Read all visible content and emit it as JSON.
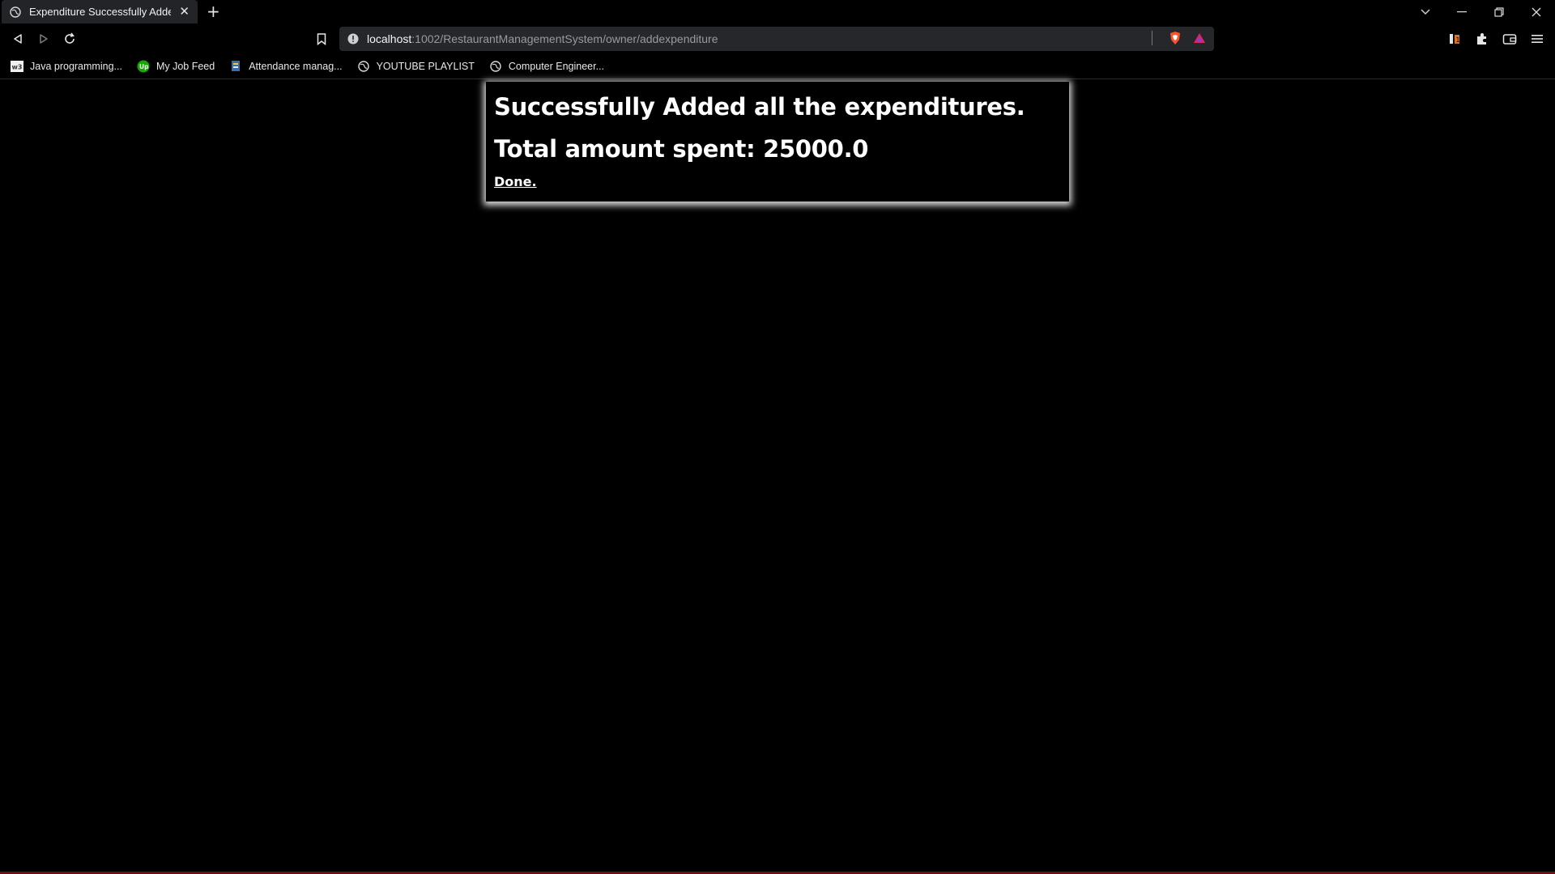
{
  "browser": {
    "tab": {
      "title": "Expenditure Successfully Added."
    },
    "address": {
      "host": "localhost",
      "path": ":1002/RestaurantManagementSystem/owner/addexpenditure"
    },
    "bookmarks": [
      {
        "label": "Java programming...",
        "icon": "w3-icon"
      },
      {
        "label": "My Job Feed",
        "icon": "upwork-icon"
      },
      {
        "label": "Attendance manag...",
        "icon": "app-icon"
      },
      {
        "label": "YOUTUBE PLAYLIST",
        "icon": "globe-icon"
      },
      {
        "label": "Computer Engineer...",
        "icon": "globe-icon"
      }
    ],
    "colors": {
      "brave_orange": "#fb542b",
      "upwork_green": "#14a800",
      "rewards_red": "#e0245e"
    }
  },
  "page": {
    "message": "Successfully Added all the expenditures.",
    "total": "Total amount spent: 25000.0",
    "done_label": "Done."
  }
}
